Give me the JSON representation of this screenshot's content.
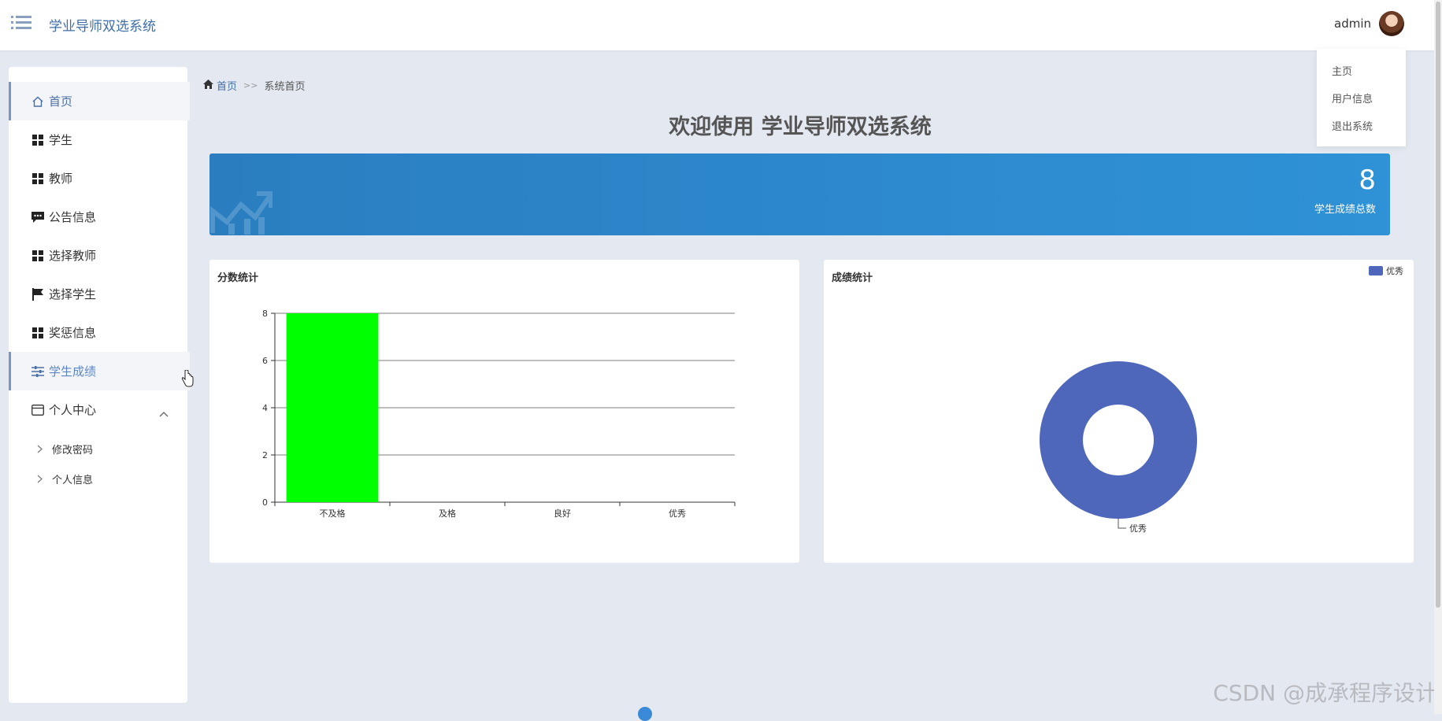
{
  "header": {
    "app_title": "学业导师双选系统",
    "username": "admin",
    "dropdown": [
      "主页",
      "用户信息",
      "退出系统"
    ]
  },
  "sidebar": {
    "items": [
      {
        "label": "首页",
        "icon": "home-icon"
      },
      {
        "label": "学生",
        "icon": "grid-icon"
      },
      {
        "label": "教师",
        "icon": "grid-icon"
      },
      {
        "label": "公告信息",
        "icon": "message-icon"
      },
      {
        "label": "选择教师",
        "icon": "grid-icon"
      },
      {
        "label": "选择学生",
        "icon": "flag-icon"
      },
      {
        "label": "奖惩信息",
        "icon": "grid-icon"
      },
      {
        "label": "学生成绩",
        "icon": "sliders-icon"
      },
      {
        "label": "个人中心",
        "icon": "wallet-icon"
      }
    ],
    "subitems": [
      "修改密码",
      "个人信息"
    ]
  },
  "breadcrumb": {
    "home": "首页",
    "sep": ">>",
    "current": "系统首页"
  },
  "welcome": "欢迎使用 学业导师双选系统",
  "stat": {
    "value": "8",
    "label": "学生成绩总数"
  },
  "colors": {
    "accent": "#3f6ea8",
    "banner": "#2a7ec0",
    "bar": "#00ff00",
    "pie": "#4f67bb"
  },
  "bar_card": {
    "title": "分数统计"
  },
  "pie_card": {
    "title": "成绩统计"
  },
  "watermark": "CSDN @成承程序设计",
  "chart_data": [
    {
      "type": "bar",
      "title": "分数统计",
      "categories": [
        "不及格",
        "及格",
        "良好",
        "优秀"
      ],
      "values": [
        8,
        0,
        0,
        0
      ],
      "yticks": [
        "0",
        "2",
        "4",
        "6",
        "8"
      ],
      "ylim": [
        0,
        8
      ],
      "grid": true
    },
    {
      "type": "pie",
      "title": "成绩统计",
      "labels": [
        "优秀"
      ],
      "values": [
        8
      ],
      "legend": "top-right",
      "donut": true
    }
  ]
}
